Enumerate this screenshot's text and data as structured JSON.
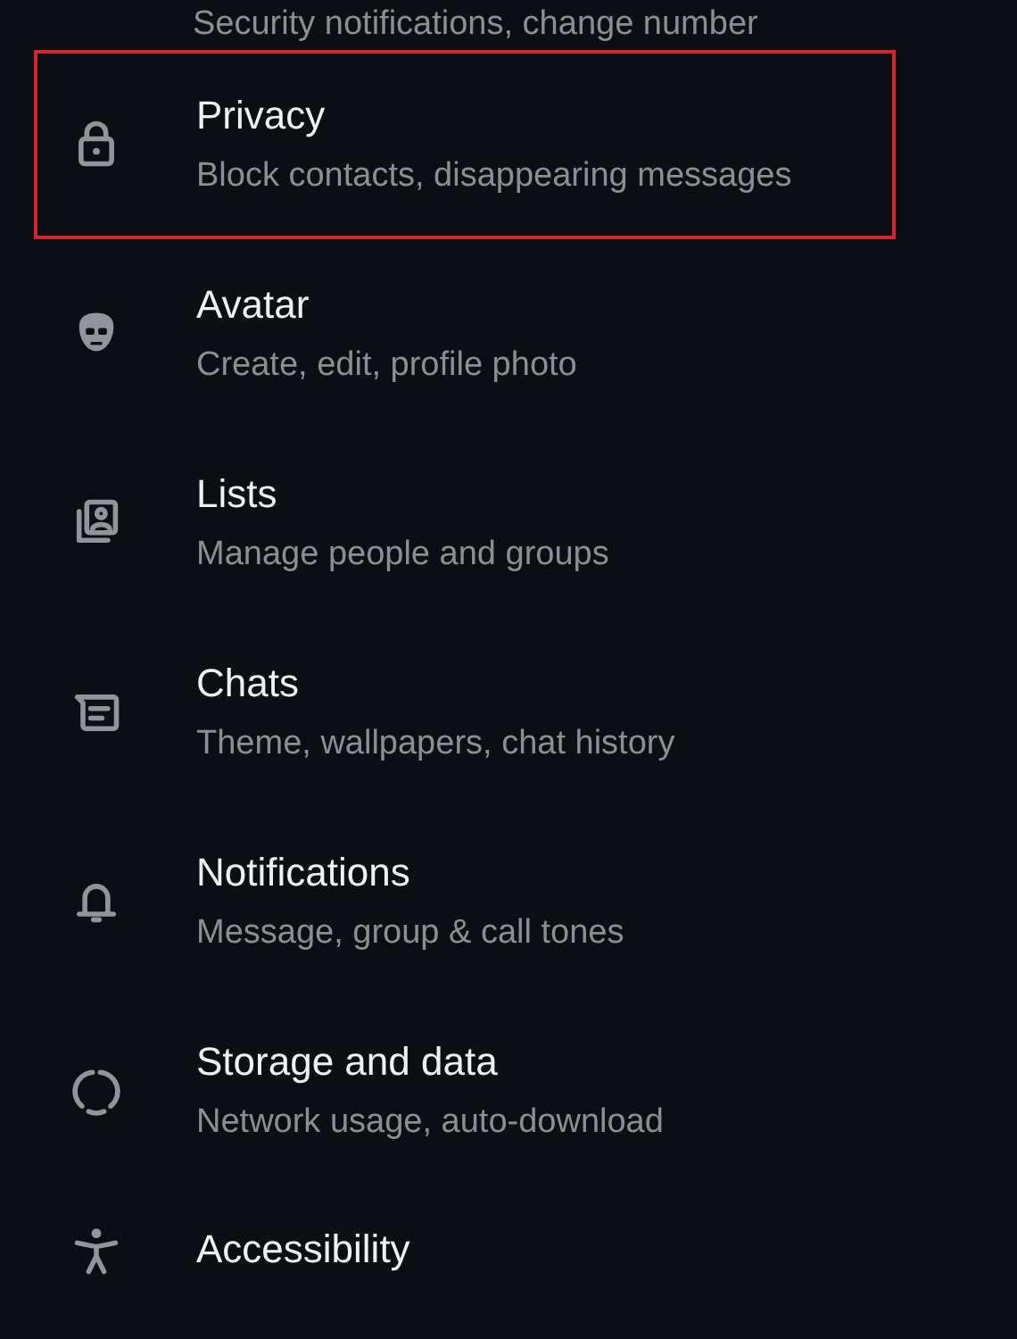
{
  "top_subtitle": "Security notifications, change number",
  "items": [
    {
      "kind": "lock",
      "title": "Privacy",
      "subtitle": "Block contacts, disappearing messages",
      "highlighted": true
    },
    {
      "kind": "avatar",
      "title": "Avatar",
      "subtitle": "Create, edit, profile photo",
      "highlighted": false
    },
    {
      "kind": "lists",
      "title": "Lists",
      "subtitle": "Manage people and groups",
      "highlighted": false
    },
    {
      "kind": "chats",
      "title": "Chats",
      "subtitle": "Theme, wallpapers, chat history",
      "highlighted": false
    },
    {
      "kind": "bell",
      "title": "Notifications",
      "subtitle": "Message, group & call tones",
      "highlighted": false
    },
    {
      "kind": "storage",
      "title": "Storage and data",
      "subtitle": "Network usage, auto-download",
      "highlighted": false
    },
    {
      "kind": "accessibility",
      "title": "Accessibility",
      "highlighted": false
    }
  ]
}
